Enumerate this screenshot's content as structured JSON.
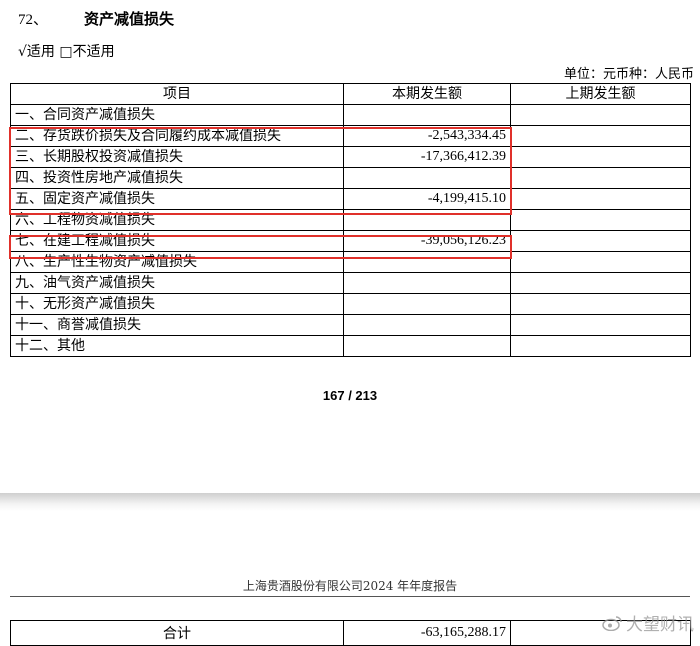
{
  "section": {
    "number": "72、",
    "title": "资产减值损失"
  },
  "applicability": "√适用 □不适用",
  "unit": "单位：元币种：人民币",
  "table": {
    "headers": [
      "项目",
      "本期发生额",
      "上期发生额"
    ],
    "rows": [
      {
        "item": "一、合同资产减值损失",
        "current": "",
        "previous": ""
      },
      {
        "item": "二、存货跌价损失及合同履约成本减值损失",
        "current": "-2,543,334.45",
        "previous": ""
      },
      {
        "item": "三、长期股权投资减值损失",
        "current": "-17,366,412.39",
        "previous": ""
      },
      {
        "item": "四、投资性房地产减值损失",
        "current": "",
        "previous": ""
      },
      {
        "item": "五、固定资产减值损失",
        "current": "-4,199,415.10",
        "previous": ""
      },
      {
        "item": "六、工程物资减值损失",
        "current": "",
        "previous": ""
      },
      {
        "item": "七、在建工程减值损失",
        "current": "-39,056,126.23",
        "previous": ""
      },
      {
        "item": "八、生产性生物资产减值损失",
        "current": "",
        "previous": ""
      },
      {
        "item": "九、油气资产减值损失",
        "current": "",
        "previous": ""
      },
      {
        "item": "十、无形资产减值损失",
        "current": "",
        "previous": ""
      },
      {
        "item": "十一、商誉减值损失",
        "current": "",
        "previous": ""
      },
      {
        "item": "十二、其他",
        "current": "",
        "previous": ""
      }
    ]
  },
  "page_number": "167 / 213",
  "report_header": "上海贵酒股份有限公司2024 年年度报告",
  "total_row": {
    "label": "合计",
    "current": "-63,165,288.17",
    "previous": ""
  },
  "watermark": {
    "text": "大望财讯",
    "icon": "weibo-icon"
  },
  "colors": {
    "highlight_box": "#e0302a"
  }
}
